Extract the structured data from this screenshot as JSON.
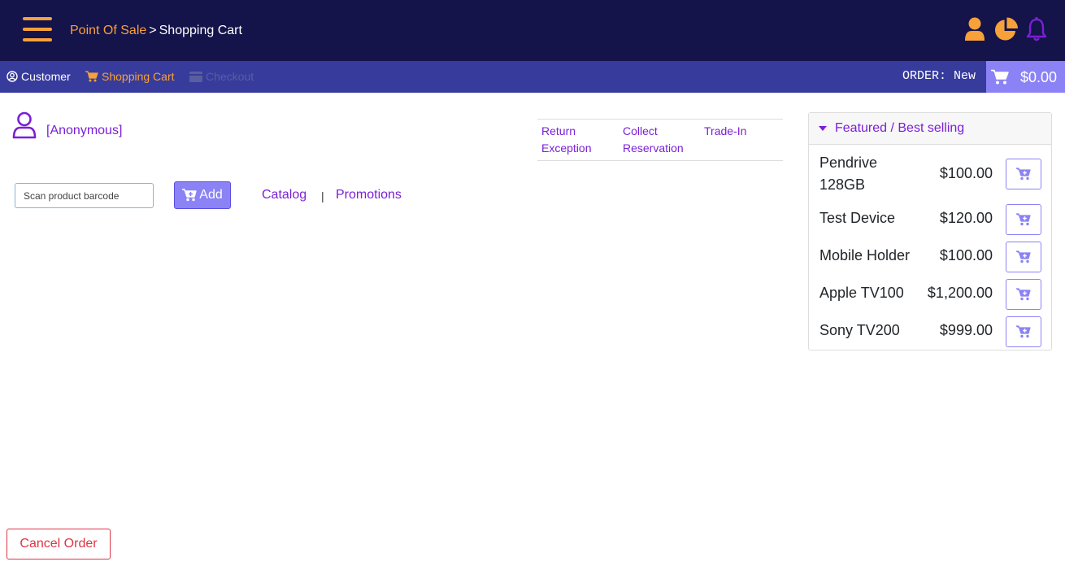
{
  "header": {
    "breadcrumb_root": "Point Of Sale",
    "breadcrumb_separator": ">",
    "breadcrumb_current": "Shopping Cart",
    "icons": [
      "user-icon",
      "pie-chart-icon",
      "bell-icon"
    ]
  },
  "subnav": {
    "customer_label": "Customer",
    "cart_label": "Shopping Cart",
    "checkout_label": "Checkout",
    "order_label": "ORDER: New",
    "cart_total": "$0.00"
  },
  "customer": {
    "name": "[Anonymous]"
  },
  "actions": {
    "return_exception": "Return Exception",
    "collect_reservation": "Collect Reservation",
    "trade_in": "Trade-In"
  },
  "barcode": {
    "placeholder": "Scan product barcode",
    "value": "",
    "add_label": "Add",
    "catalog_label": "Catalog",
    "separator": "|",
    "promotions_label": "Promotions"
  },
  "featured": {
    "title": "Featured / Best selling",
    "products": [
      {
        "name": "Pendrive 128GB",
        "price": "$100.00"
      },
      {
        "name": "Test Device",
        "price": "$120.00"
      },
      {
        "name": "Mobile Holder",
        "price": "$100.00"
      },
      {
        "name": "Apple TV100",
        "price": "$1,200.00"
      },
      {
        "name": "Sony TV200",
        "price": "$999.00"
      }
    ]
  },
  "footer": {
    "cancel_label": "Cancel Order"
  },
  "colors": {
    "header_bg": "#14134a",
    "subnav_bg": "#373b9c",
    "accent_orange": "#f7a13a",
    "accent_purple": "#7b1fd6",
    "button_purple": "#8b82f6",
    "danger": "#dc3545"
  }
}
